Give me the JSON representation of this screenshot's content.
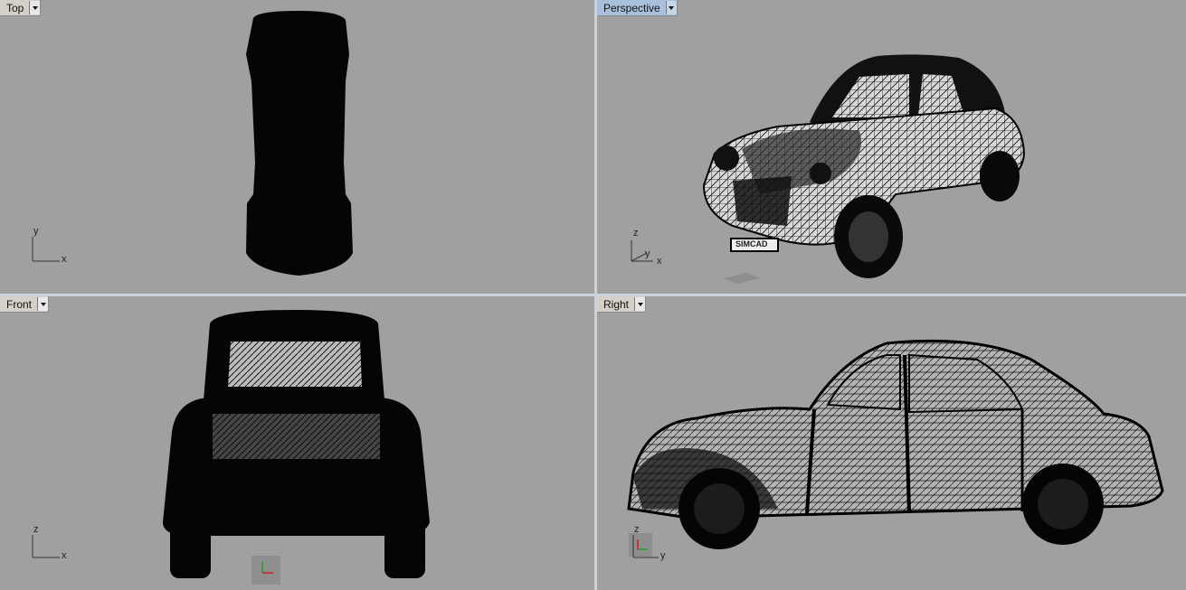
{
  "viewports": {
    "top": {
      "label": "Top",
      "axis_v": "y",
      "axis_h": "x",
      "active": false
    },
    "persp": {
      "label": "Perspective",
      "axis_v": "z",
      "axis_y": "y",
      "axis_h": "x",
      "active": true
    },
    "front": {
      "label": "Front",
      "axis_v": "z",
      "axis_h": "x",
      "active": false
    },
    "right": {
      "label": "Right",
      "axis_v": "z",
      "axis_h": "y",
      "active": false
    }
  },
  "plate_text": "SIMCAD",
  "colors": {
    "viewport_bg": "#a0a0a0",
    "active_tab": "#a9c0dc",
    "wire": "#000000",
    "axis_x": "#d02020",
    "axis_y": "#20a020"
  },
  "icons": [
    "chevron-down-icon",
    "axis-triad-icon",
    "cplane-grid-icon"
  ]
}
